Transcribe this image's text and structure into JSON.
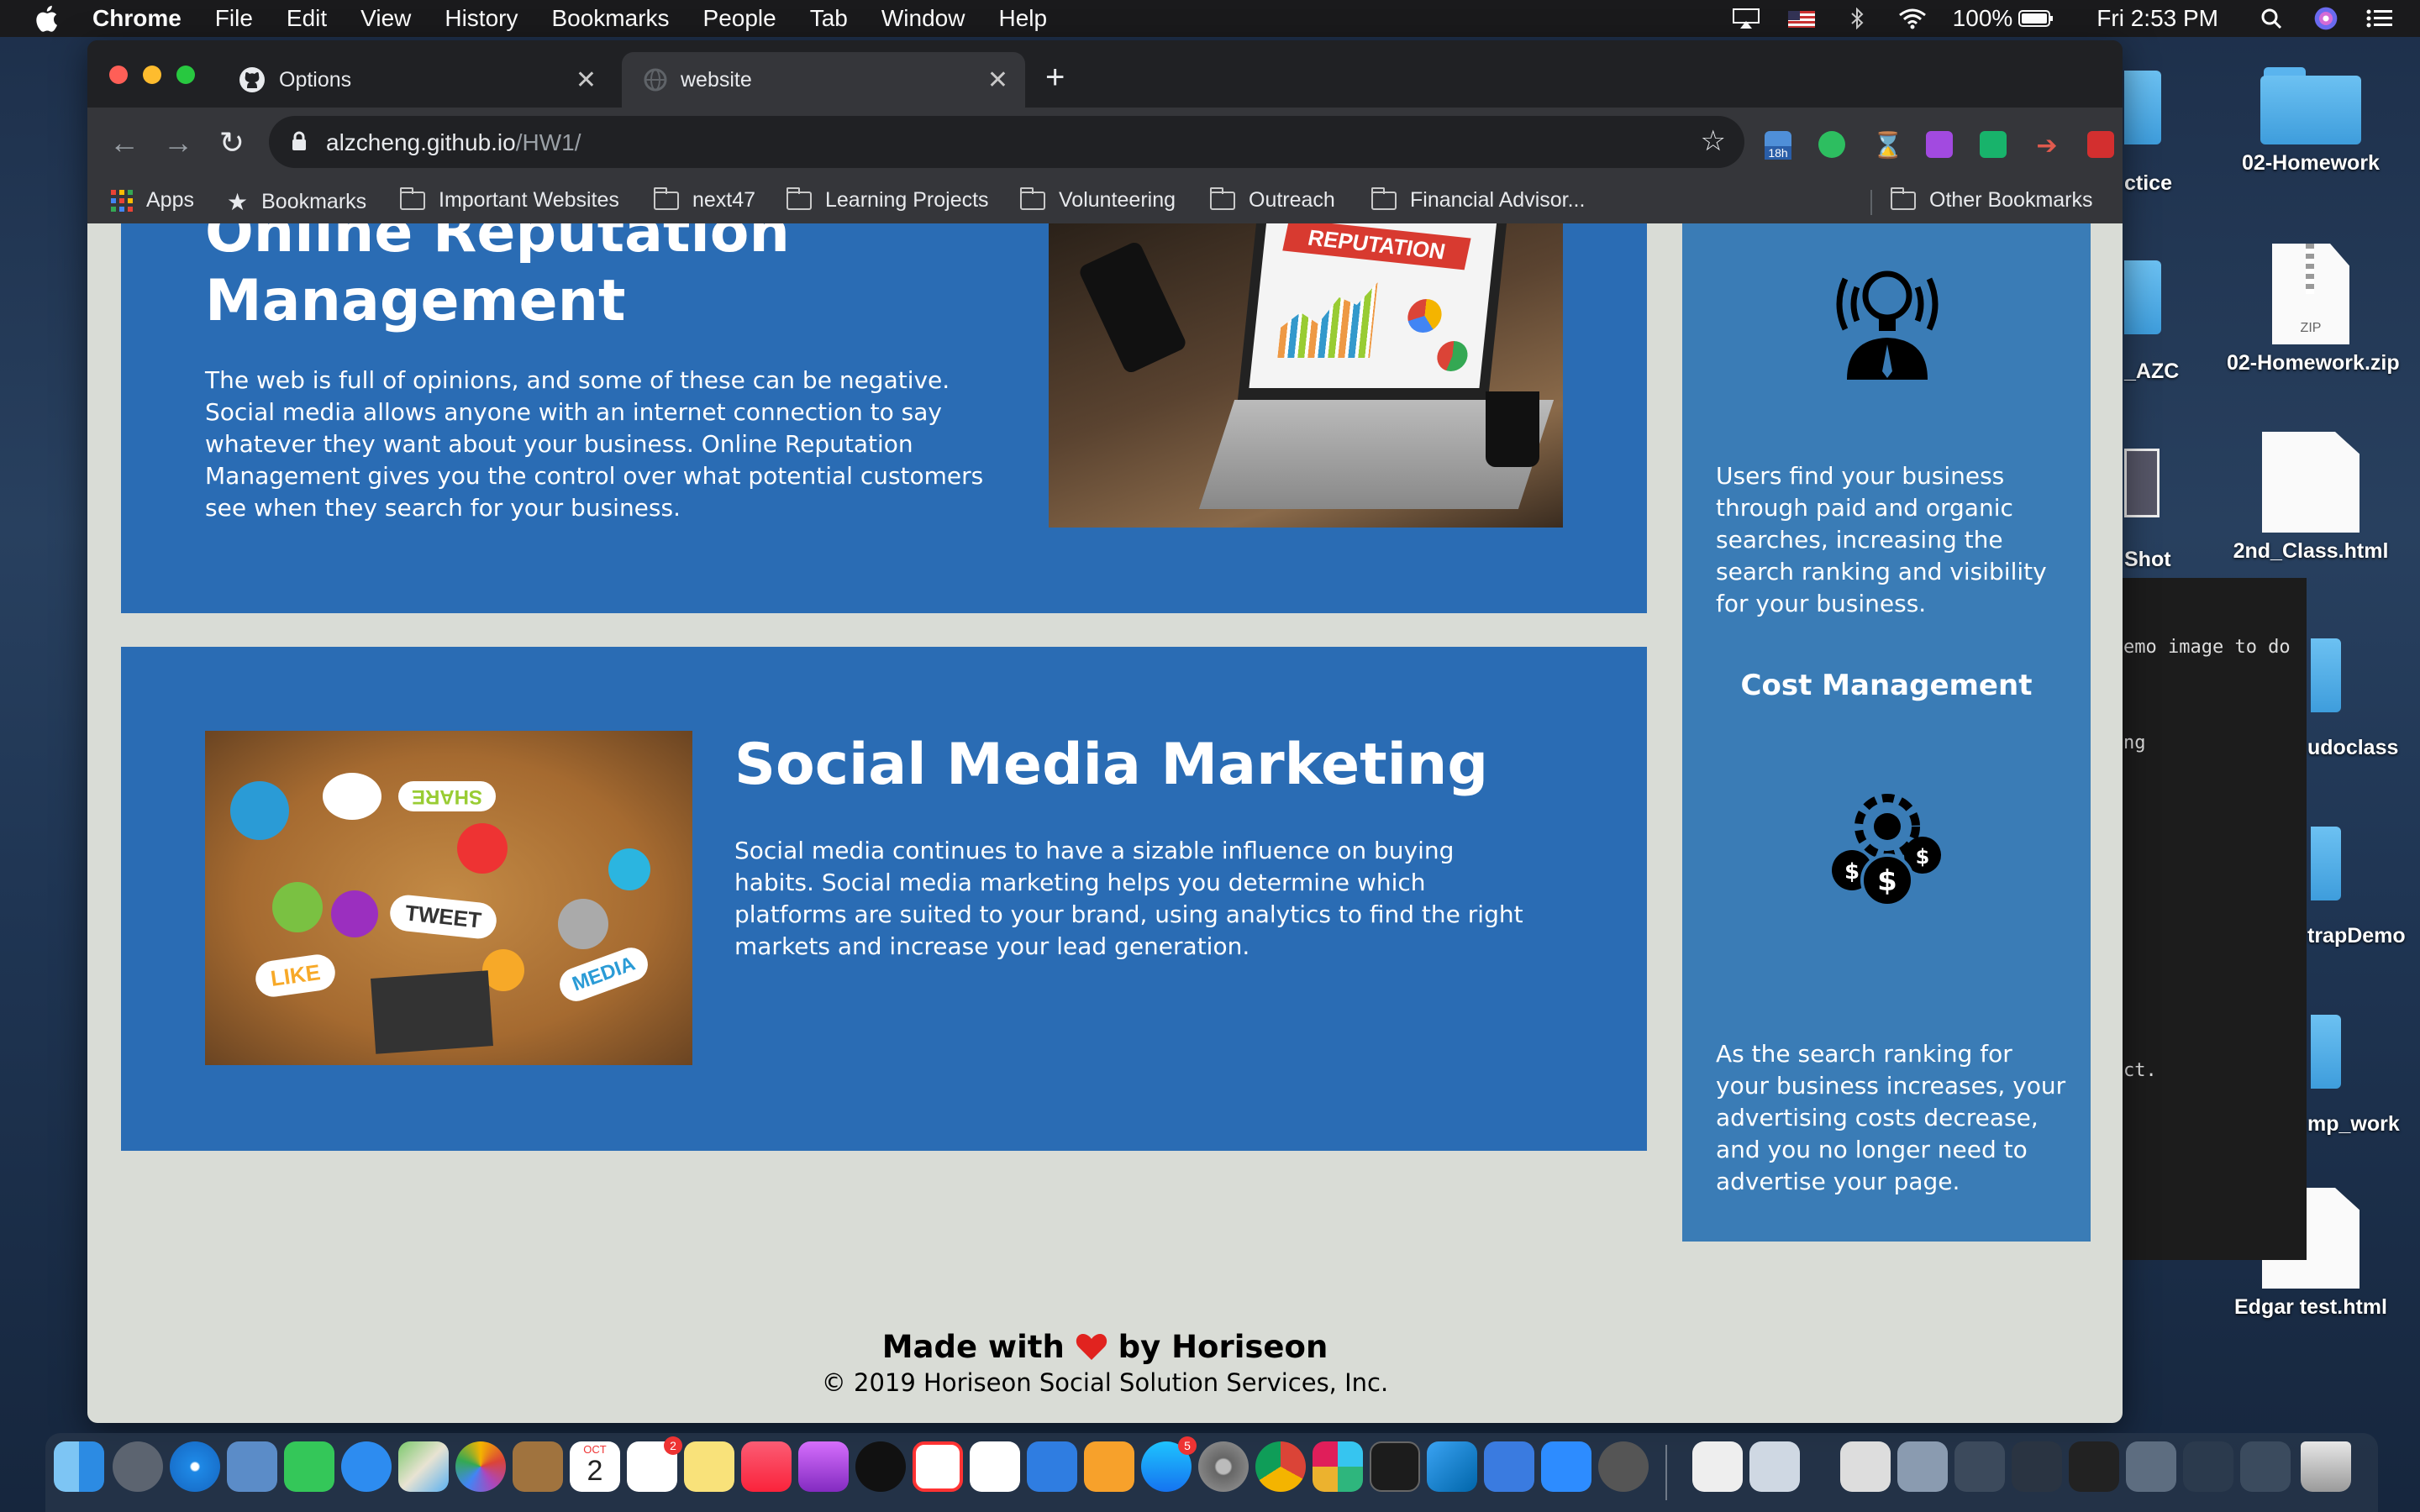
{
  "menubar": {
    "app": "Chrome",
    "items": [
      "File",
      "Edit",
      "View",
      "History",
      "Bookmarks",
      "People",
      "Tab",
      "Window",
      "Help"
    ],
    "battery": "100%",
    "clock": "Fri 2:53 PM"
  },
  "desktop": {
    "icons": [
      {
        "label": "02-Homework",
        "kind": "folder"
      },
      {
        "label": "02-Homework.zip",
        "kind": "zip"
      },
      {
        "label": "2nd_Class.html",
        "kind": "doc"
      },
      {
        "label": "Edgar test.html",
        "kind": "doc"
      }
    ],
    "partial_labels": [
      "ctice",
      "_AZC",
      "Shot",
      "udoclass",
      "trapDemo",
      "mp_work"
    ],
    "terminal_lines": [
      "emo image to do",
      "ng",
      "ct."
    ]
  },
  "browser": {
    "tabs": [
      {
        "title": "Options",
        "active": false
      },
      {
        "title": "website",
        "active": true
      }
    ],
    "url_host": "alzcheng.github.io",
    "url_path": "/HW1/",
    "bookmarks": [
      "Apps",
      "Bookmarks",
      "Important Websites",
      "next47",
      "Learning Projects",
      "Volunteering",
      "Outreach",
      "Financial Advisor...",
      "Other Bookmarks"
    ],
    "ext_badge": "18h"
  },
  "page": {
    "orm": {
      "title_line1": "Online Reputation",
      "title_line2": "Management",
      "body": "The web is full of opinions, and some of these can be negative. Social media allows anyone with an internet connection to say whatever they want about your business. Online Reputation Management gives you the control over what potential customers see when they search for your business.",
      "image_text": "REPUTATION"
    },
    "smm": {
      "title": "Social Media Marketing",
      "body": "Social media continues to have a sizable influence on buying habits. Social media marketing helps you determine which platforms are suited to your brand, using analytics to find the right markets and increase your lead generation.",
      "image_words": [
        "SHARE",
        "TWEET",
        "LIKE",
        "MEDIA"
      ]
    },
    "aside": {
      "lead_body": "Users find your business through paid and organic searches, increasing the search ranking and visibility for your business.",
      "cost_title": "Cost Management",
      "cost_body": "As the search ranking for your business increases, your advertising costs decrease, and you no longer need to advertise your page."
    },
    "footer": {
      "made_prefix": "Made with",
      "made_suffix": "by Horiseon",
      "copyright": "© 2019 Horiseon Social Solution Services, Inc."
    }
  },
  "dock": {
    "calendar_month": "OCT",
    "calendar_day": "2",
    "badge_reminders": "2",
    "badge_appstore": "5"
  },
  "colors": {
    "section_bg": "#2a6cb4",
    "aside_bg": "#3a7cb6",
    "page_bg": "#d9dcd6",
    "chrome_dark": "#202124",
    "chrome_toolbar": "#35363a"
  }
}
